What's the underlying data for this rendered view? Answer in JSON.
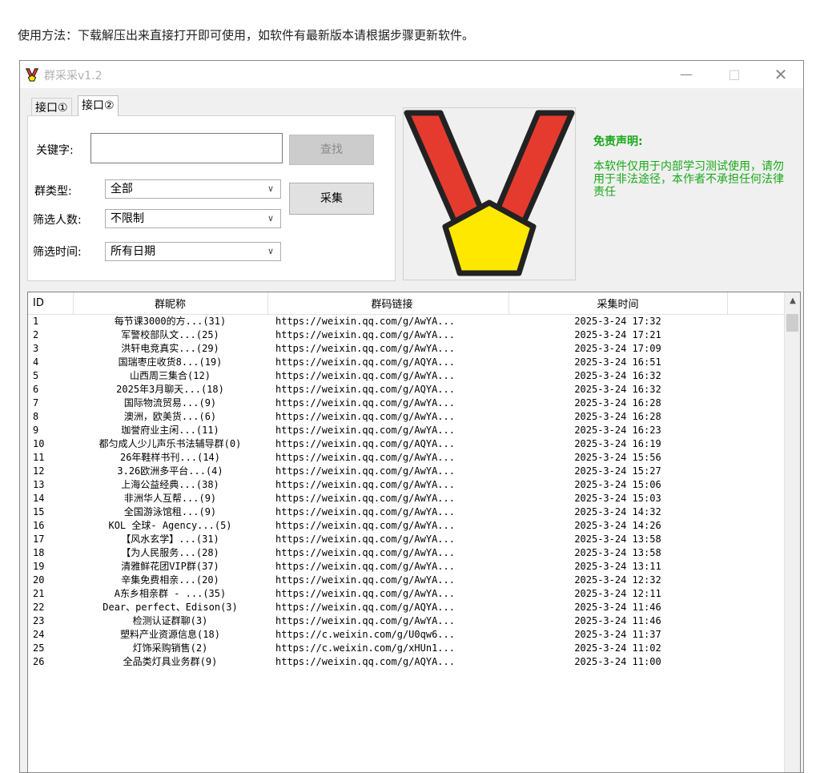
{
  "caption": "使用方法：下载解压出来直接打开即可使用，如软件有最新版本请根据步骤更新软件。",
  "window": {
    "title": "群采采v1.2",
    "minimize": "—",
    "maximize": "□",
    "close": "✕"
  },
  "tabs": [
    {
      "label": "接口①"
    },
    {
      "label": "接口②"
    }
  ],
  "form": {
    "keyword_label": "关键字:",
    "keyword_value": "",
    "search_button": "查找",
    "collect_button": "采集",
    "group_type_label": "群类型:",
    "group_type_value": "全部",
    "members_label": "筛选人数:",
    "members_value": "不限制",
    "time_label": "筛选时间:",
    "time_value": "所有日期"
  },
  "disclaimer": {
    "title": "免责声明:",
    "body": "本软件仅用于内部学习测试使用，请勿用于非法途径，本作者不承担任何法律责任"
  },
  "colors": {
    "accent_green": "#18a818",
    "logo_red": "#e53b2e",
    "logo_yellow": "#ffe800"
  },
  "table": {
    "headers": [
      "ID",
      "群昵称",
      "群码链接",
      "采集时间"
    ],
    "rows": [
      [
        "1",
        "每节课3000的方...(31)",
        "https://weixin.qq.com/g/AwYA...",
        "2025-3-24 17:32"
      ],
      [
        "2",
        "军警校部队文...(25)",
        "https://weixin.qq.com/g/AwYA...",
        "2025-3-24 17:21"
      ],
      [
        "3",
        "洪轩电竞真实...(29)",
        "https://weixin.qq.com/g/AwYA...",
        "2025-3-24 17:09"
      ],
      [
        "4",
        "国瑞枣庄收货8...(19)",
        "https://weixin.qq.com/g/AQYA...",
        "2025-3-24 16:51"
      ],
      [
        "5",
        "山西周三集合(12)",
        "https://weixin.qq.com/g/AwYA...",
        "2025-3-24 16:32"
      ],
      [
        "6",
        "2025年3月聊天...(18)",
        "https://weixin.qq.com/g/AQYA...",
        "2025-3-24 16:32"
      ],
      [
        "7",
        "国际物流贸易...(9)",
        "https://weixin.qq.com/g/AwYA...",
        "2025-3-24 16:28"
      ],
      [
        "8",
        "澳洲，欧美货...(6)",
        "https://weixin.qq.com/g/AwYA...",
        "2025-3-24 16:28"
      ],
      [
        "9",
        "珈誉府业主闲...(11)",
        "https://weixin.qq.com/g/AwYA...",
        "2025-3-24 16:23"
      ],
      [
        "10",
        "都匀成人少儿声乐书法辅导群(0)",
        "https://weixin.qq.com/g/AQYA...",
        "2025-3-24 16:19"
      ],
      [
        "11",
        "26年鞋样书刊...(14)",
        "https://weixin.qq.com/g/AwYA...",
        "2025-3-24 15:56"
      ],
      [
        "12",
        "3.26欧洲多平台...(4)",
        "https://weixin.qq.com/g/AwYA...",
        "2025-3-24 15:27"
      ],
      [
        "13",
        "上海公益经典...(38)",
        "https://weixin.qq.com/g/AwYA...",
        "2025-3-24 15:06"
      ],
      [
        "14",
        "非洲华人互帮...(9)",
        "https://weixin.qq.com/g/AwYA...",
        "2025-3-24 15:03"
      ],
      [
        "15",
        "全国游泳馆租...(9)",
        "https://weixin.qq.com/g/AwYA...",
        "2025-3-24 14:32"
      ],
      [
        "16",
        "KOL 全球- Agency...(5)",
        "https://weixin.qq.com/g/AwYA...",
        "2025-3-24 14:26"
      ],
      [
        "17",
        "【风水玄学】...(31)",
        "https://weixin.qq.com/g/AwYA...",
        "2025-3-24 13:58"
      ],
      [
        "18",
        "【为人民服务...(28)",
        "https://weixin.qq.com/g/AwYA...",
        "2025-3-24 13:58"
      ],
      [
        "19",
        "清雅鲜花团VIP群(37)",
        "https://weixin.qq.com/g/AwYA...",
        "2025-3-24 13:11"
      ],
      [
        "20",
        "辛集免费相亲...(20)",
        "https://weixin.qq.com/g/AwYA...",
        "2025-3-24 12:32"
      ],
      [
        "21",
        "A东乡相亲群 - ...(35)",
        "https://weixin.qq.com/g/AwYA...",
        "2025-3-24 12:11"
      ],
      [
        "22",
        "Dear、perfect、Edison(3)",
        "https://weixin.qq.com/g/AQYA...",
        "2025-3-24 11:46"
      ],
      [
        "23",
        "检测认证群聊(3)",
        "https://weixin.qq.com/g/AwYA...",
        "2025-3-24 11:46"
      ],
      [
        "24",
        "塑料产业资源信息(18)",
        "https://c.weixin.com/g/U0qw6...",
        "2025-3-24 11:37"
      ],
      [
        "25",
        "灯饰采购销售(2)",
        "https://c.weixin.com/g/xHUn1...",
        "2025-3-24 11:02"
      ],
      [
        "26",
        "全品类灯具业务群(9)",
        "https://weixin.qq.com/g/AQYA...",
        "2025-3-24 11:00"
      ]
    ]
  }
}
